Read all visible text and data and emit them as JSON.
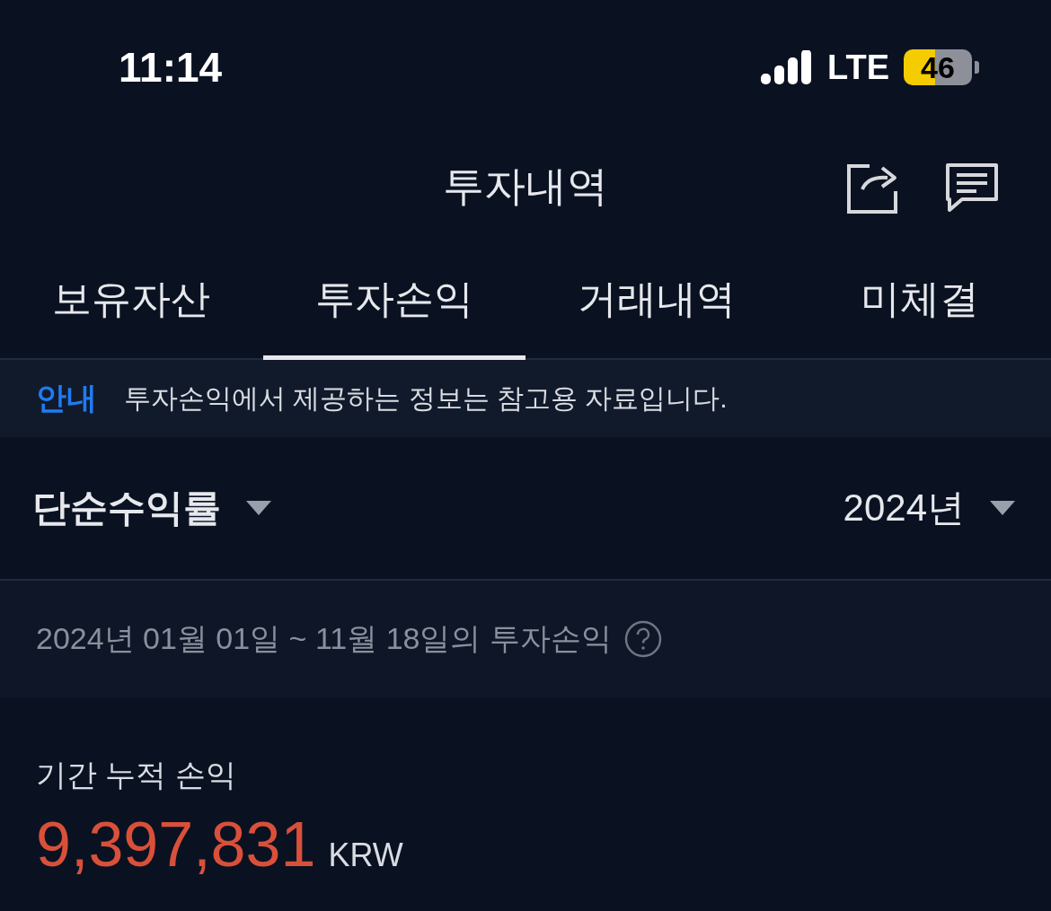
{
  "status_bar": {
    "time": "11:14",
    "network": "LTE",
    "battery": "46"
  },
  "header": {
    "title": "투자내역"
  },
  "tabs": [
    {
      "label": "보유자산",
      "selected": false
    },
    {
      "label": "투자손익",
      "selected": true
    },
    {
      "label": "거래내역",
      "selected": false
    },
    {
      "label": "미체결",
      "selected": false
    }
  ],
  "notice": {
    "tag": "안내",
    "text": "투자손익에서 제공하는 정보는 참고용 자료입니다."
  },
  "filters": {
    "metric": "단순수익률",
    "year": "2024년"
  },
  "period": {
    "text": "2024년 01월 01일 ~ 11월 18일의 투자손익"
  },
  "summary": {
    "label": "기간 누적 손익",
    "amount": "9,397,831",
    "currency": "KRW"
  }
}
